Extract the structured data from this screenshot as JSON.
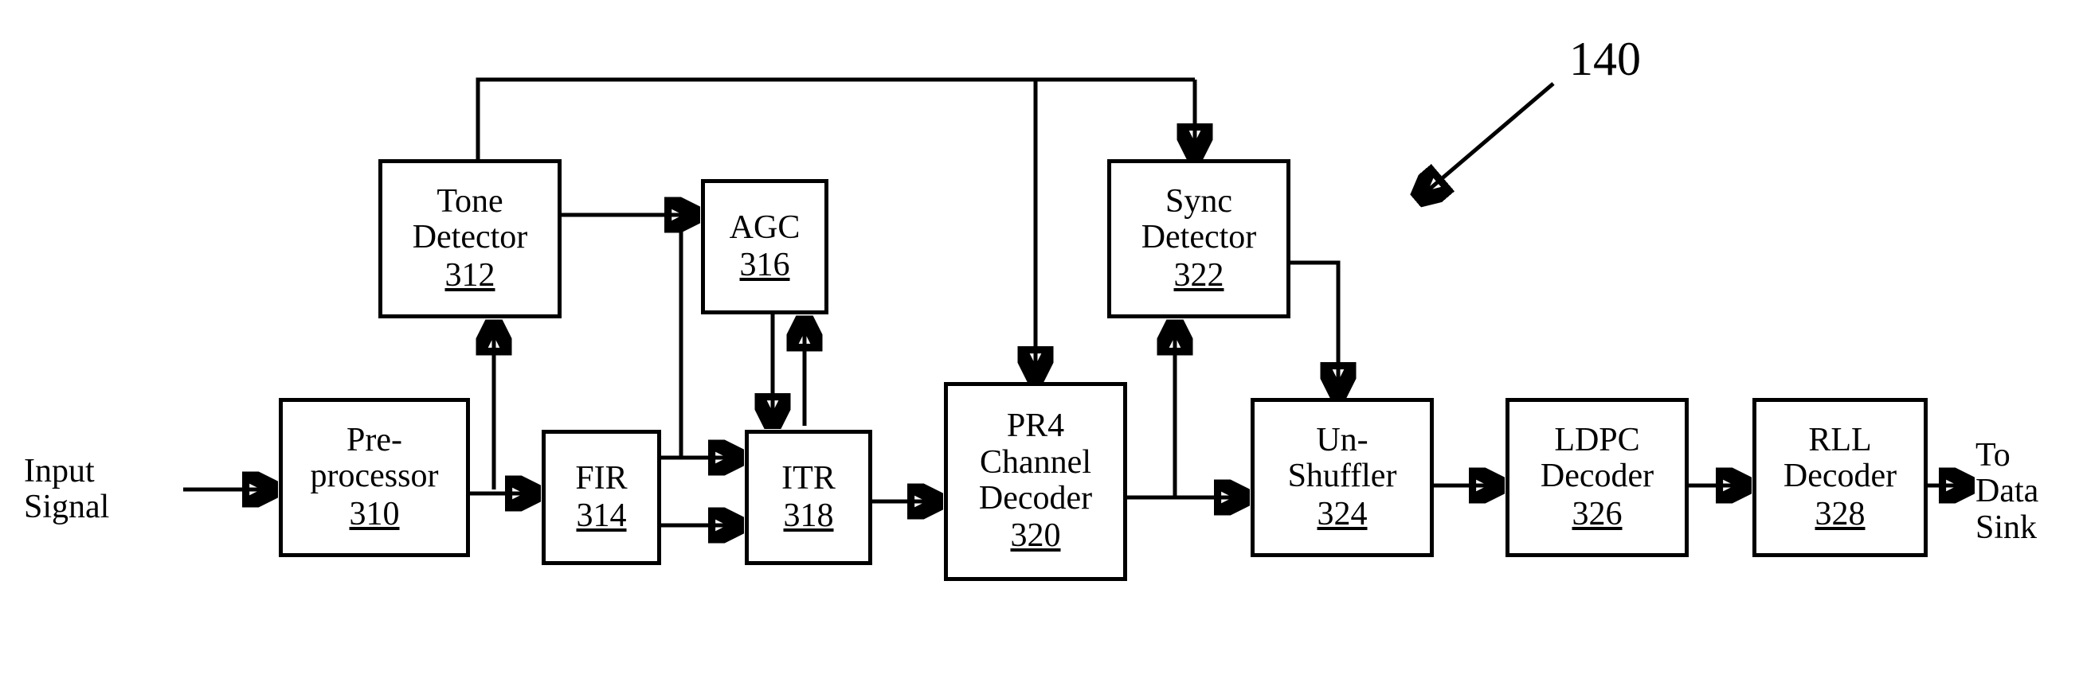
{
  "figure_number": "140",
  "io": {
    "input_label": "Input\nSignal",
    "output_label": "To\nData\nSink"
  },
  "blocks": {
    "preproc": {
      "label": "Pre-\nprocessor",
      "ref": "310"
    },
    "tone": {
      "label": "Tone\nDetector",
      "ref": "312"
    },
    "fir": {
      "label": "FIR",
      "ref": "314"
    },
    "agc": {
      "label": "AGC",
      "ref": "316"
    },
    "itr": {
      "label": "ITR",
      "ref": "318"
    },
    "pr4": {
      "label": "PR4\nChannel\nDecoder",
      "ref": "320"
    },
    "sync": {
      "label": "Sync\nDetector",
      "ref": "322"
    },
    "unshuf": {
      "label": "Un-\nShuffler",
      "ref": "324"
    },
    "ldpc": {
      "label": "LDPC\nDecoder",
      "ref": "326"
    },
    "rll": {
      "label": "RLL\nDecoder",
      "ref": "328"
    }
  }
}
